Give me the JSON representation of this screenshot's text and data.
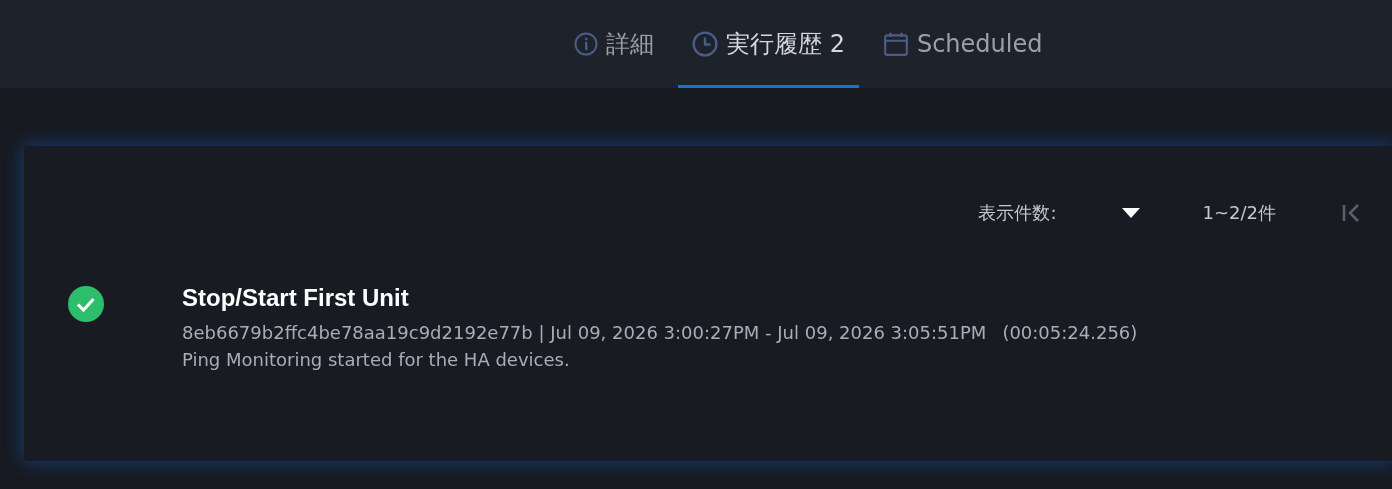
{
  "tabs": [
    {
      "label": "詳細",
      "kind": "info",
      "selected": false
    },
    {
      "label": "実行履歴 2",
      "kind": "clock",
      "selected": true
    },
    {
      "label": "Scheduled",
      "kind": "calendar",
      "selected": false
    }
  ],
  "pager": {
    "page_size_label": "表示件数:",
    "range": "1~2/2件",
    "first_disabled": true
  },
  "runs": [
    {
      "kind": "success",
      "title": "Stop/Start First Unit",
      "meta": "8eb6679b2ffc4be78aa19c9d2192e77b | Jul 09, 2026 3:00:27PM - Jul 09, 2026 3:05:51PM",
      "duration": "(00:05:24.256)",
      "message": "Ping Monitoring started for the HA devices."
    }
  ]
}
